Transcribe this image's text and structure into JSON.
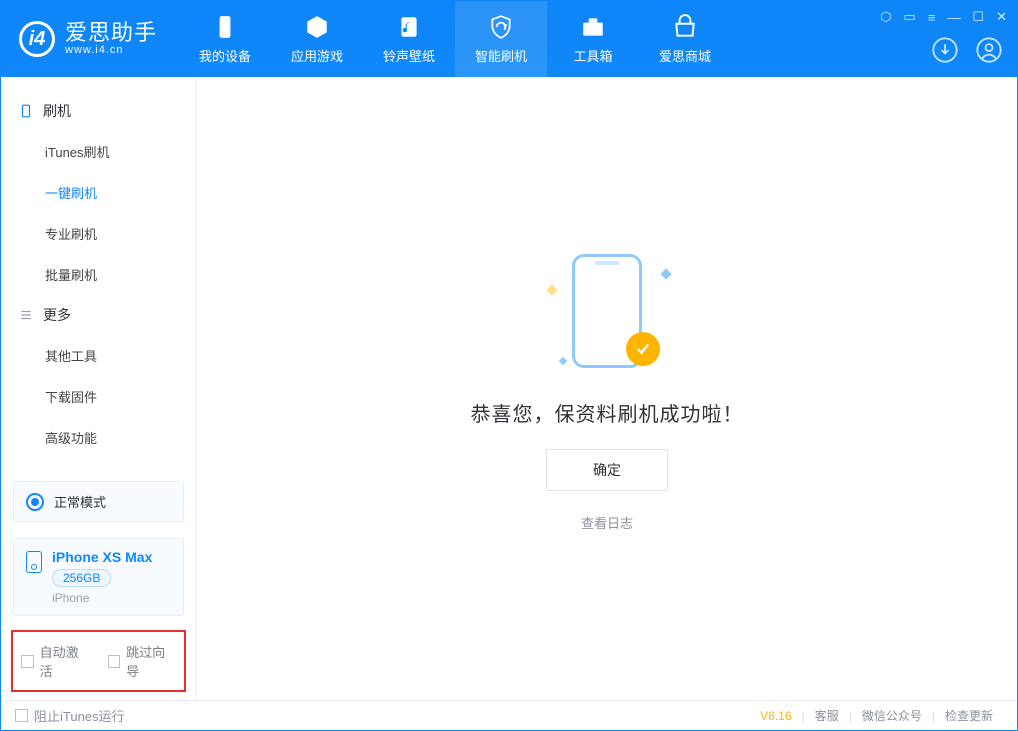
{
  "app": {
    "name_cn": "爱思助手",
    "name_en": "www.i4.cn"
  },
  "topnav": [
    {
      "label": "我的设备"
    },
    {
      "label": "应用游戏"
    },
    {
      "label": "铃声壁纸"
    },
    {
      "label": "智能刷机"
    },
    {
      "label": "工具箱"
    },
    {
      "label": "爱思商城"
    }
  ],
  "sidebar": {
    "group1": {
      "title": "刷机",
      "items": [
        {
          "label": "iTunes刷机"
        },
        {
          "label": "一键刷机"
        },
        {
          "label": "专业刷机"
        },
        {
          "label": "批量刷机"
        }
      ]
    },
    "group2": {
      "title": "更多",
      "items": [
        {
          "label": "其他工具"
        },
        {
          "label": "下载固件"
        },
        {
          "label": "高级功能"
        }
      ]
    },
    "mode": {
      "label": "正常模式"
    },
    "device": {
      "name": "iPhone XS Max",
      "capacity": "256GB",
      "type": "iPhone"
    },
    "opts": {
      "auto_activate": "自动激活",
      "skip_guide": "跳过向导"
    }
  },
  "main": {
    "success_msg": "恭喜您，保资料刷机成功啦！",
    "ok": "确定",
    "view_log": "查看日志"
  },
  "footer": {
    "block_itunes": "阻止iTunes运行",
    "version": "V8.16",
    "support": "客服",
    "wechat": "微信公众号",
    "update": "检查更新"
  }
}
